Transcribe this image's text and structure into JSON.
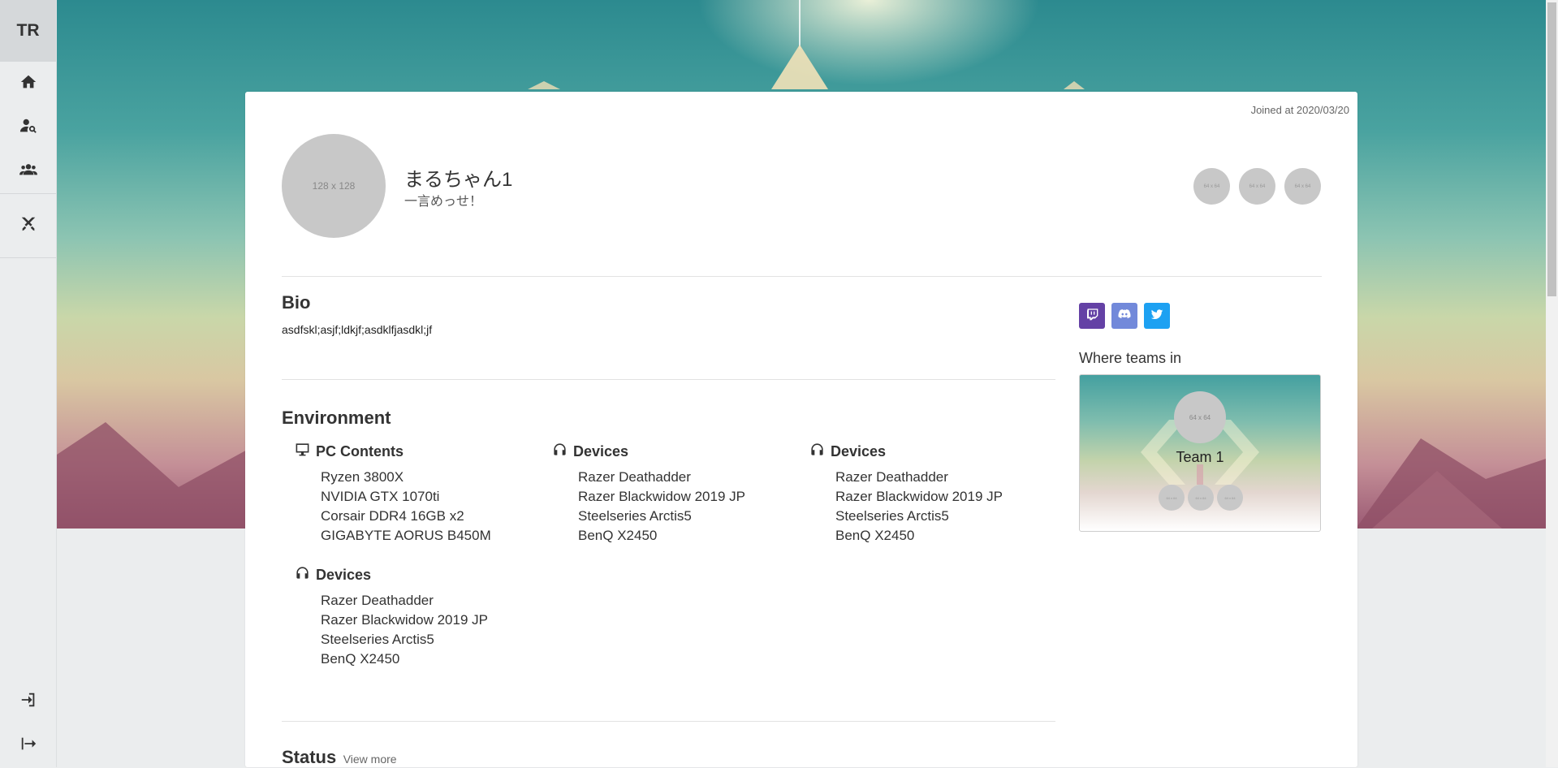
{
  "app": {
    "logo": "TR"
  },
  "sidebar": {
    "items": [
      {
        "icon": "home-icon"
      },
      {
        "icon": "user-search-icon"
      },
      {
        "icon": "users-icon"
      },
      {
        "icon": "crossed-swords-icon"
      }
    ],
    "bottom": [
      {
        "icon": "sign-in-icon"
      },
      {
        "icon": "sign-out-icon"
      }
    ]
  },
  "profile": {
    "joined": "Joined at 2020/03/20",
    "avatar_placeholder": "128 x 128",
    "name": "まるちゃん1",
    "catchphrase": "一言めっせ！",
    "mini_avatars": [
      "64 x 64",
      "64 x 64",
      "64 x 64"
    ]
  },
  "bio": {
    "heading": "Bio",
    "text": "asdfskl;asjf;ldkjf;asdklfjasdkl;jf"
  },
  "environment": {
    "heading": "Environment",
    "groups": [
      {
        "icon": "monitor-icon",
        "title": "PC Contents",
        "items": [
          "Ryzen 3800X",
          "NVIDIA GTX 1070ti",
          "Corsair DDR4 16GB x2",
          "GIGABYTE AORUS B450M"
        ]
      },
      {
        "icon": "headphones-icon",
        "title": "Devices",
        "items": [
          "Razer Deathadder",
          "Razer Blackwidow 2019 JP",
          "Steelseries Arctis5",
          "BenQ X2450"
        ]
      },
      {
        "icon": "headphones-icon",
        "title": "Devices",
        "items": [
          "Razer Deathadder",
          "Razer Blackwidow 2019 JP",
          "Steelseries Arctis5",
          "BenQ X2450"
        ]
      },
      {
        "icon": "headphones-icon",
        "title": "Devices",
        "items": [
          "Razer Deathadder",
          "Razer Blackwidow 2019 JP",
          "Steelseries Arctis5",
          "BenQ X2450"
        ]
      }
    ]
  },
  "status": {
    "heading": "Status",
    "link": "View more"
  },
  "social": [
    {
      "icon": "twitch-icon",
      "color": "#6441a5"
    },
    {
      "icon": "discord-icon",
      "color": "#7289da"
    },
    {
      "icon": "twitter-icon",
      "color": "#1da1f2"
    }
  ],
  "teams": {
    "heading": "Where teams in",
    "list": [
      {
        "name": "Team 1",
        "logo_placeholder": "64 x 64",
        "members": [
          "64 x 64",
          "64 x 64",
          "64 x 64"
        ]
      }
    ]
  }
}
